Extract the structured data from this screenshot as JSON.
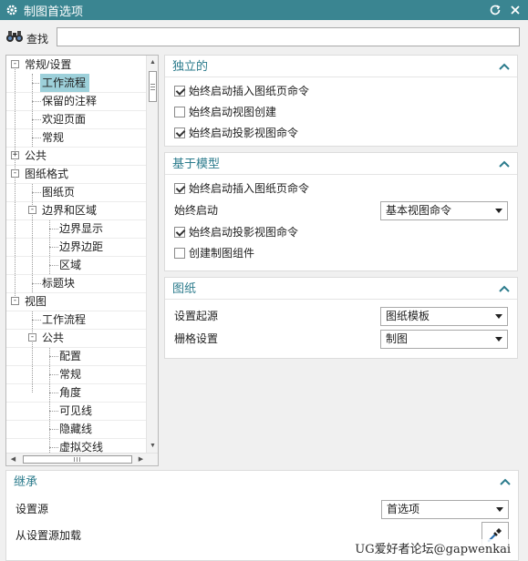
{
  "window": {
    "title": "制图首选项",
    "title_bg": "#3a8591",
    "controls": [
      "reset-icon",
      "close-icon"
    ]
  },
  "find": {
    "label": "查找",
    "value": "",
    "placeholder": ""
  },
  "tree": {
    "selected": "工作流程",
    "nodes": [
      {
        "label": "常规/设置",
        "level": 0,
        "expander": "-"
      },
      {
        "label": "工作流程",
        "level": 1,
        "selected": true
      },
      {
        "label": "保留的注释",
        "level": 1
      },
      {
        "label": "欢迎页面",
        "level": 1
      },
      {
        "label": "常规",
        "level": 1
      },
      {
        "label": "公共",
        "level": 0,
        "expander": "+"
      },
      {
        "label": "图纸格式",
        "level": 0,
        "expander": "-"
      },
      {
        "label": "图纸页",
        "level": 1
      },
      {
        "label": "边界和区域",
        "level": 1,
        "expander": "-"
      },
      {
        "label": "边界显示",
        "level": 2
      },
      {
        "label": "边界边距",
        "level": 2
      },
      {
        "label": "区域",
        "level": 2
      },
      {
        "label": "标题块",
        "level": 1
      },
      {
        "label": "视图",
        "level": 0,
        "expander": "-"
      },
      {
        "label": "工作流程",
        "level": 1
      },
      {
        "label": "公共",
        "level": 1,
        "expander": "-"
      },
      {
        "label": "配置",
        "level": 2
      },
      {
        "label": "常规",
        "level": 2
      },
      {
        "label": "角度",
        "level": 2
      },
      {
        "label": "可见线",
        "level": 2
      },
      {
        "label": "隐藏线",
        "level": 2
      },
      {
        "label": "虚拟交线",
        "level": 2
      }
    ]
  },
  "sections": {
    "independent": {
      "title": "独立的",
      "options": [
        {
          "label": "始终启动插入图纸页命令",
          "checked": true
        },
        {
          "label": "始终启动视图创建",
          "checked": false
        },
        {
          "label": "始终启动投影视图命令",
          "checked": true
        }
      ]
    },
    "model_based": {
      "title": "基于模型",
      "opt_insert_sheet": {
        "label": "始终启动插入图纸页命令",
        "checked": true
      },
      "always_start": {
        "label": "始终启动",
        "value": "基本视图命令"
      },
      "opt_projected": {
        "label": "始终启动投影视图命令",
        "checked": true
      },
      "opt_components": {
        "label": "创建制图组件",
        "checked": false
      }
    },
    "drawing": {
      "title": "图纸",
      "source": {
        "label": "设置起源",
        "value": "图纸模板"
      },
      "grid": {
        "label": "栅格设置",
        "value": "制图"
      }
    },
    "inherit": {
      "title": "继承",
      "settings_source": {
        "label": "设置源",
        "value": "首选项"
      },
      "load_label": "从设置源加载"
    }
  },
  "watermark": "UG爱好者论坛@gapwenkai",
  "colors": {
    "accent": "#2b7b8c",
    "selection": "#9dd0da",
    "panel_bg": "#ffffff",
    "window_bg": "#f0f0f0"
  }
}
